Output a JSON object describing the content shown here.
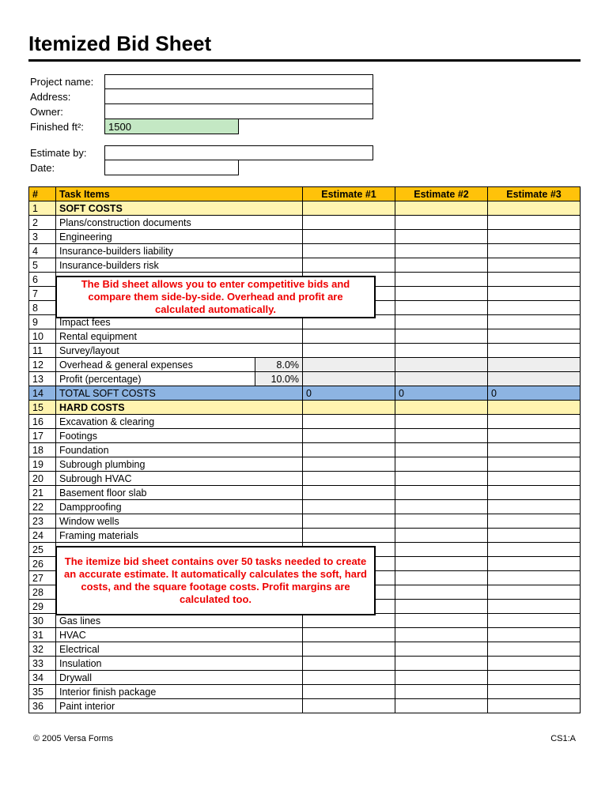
{
  "title": "Itemized Bid Sheet",
  "header": {
    "labels": {
      "project": "Project name:",
      "address": "Address:",
      "owner": "Owner:",
      "finished_ft2": "Finished ft²:",
      "estimate_by": "Estimate by:",
      "date": "Date:"
    },
    "values": {
      "project": "",
      "address": "",
      "owner": "",
      "finished_ft2": "1500",
      "estimate_by": "",
      "date": ""
    }
  },
  "columns": {
    "num": "#",
    "task": "Task Items",
    "est1": "Estimate #1",
    "est2": "Estimate #2",
    "est3": "Estimate #3"
  },
  "rows": [
    {
      "n": "1",
      "task": "SOFT COSTS",
      "class": "soft-yellow"
    },
    {
      "n": "2",
      "task": "Plans/construction documents"
    },
    {
      "n": "3",
      "task": "Engineering"
    },
    {
      "n": "4",
      "task": "Insurance-builders liability"
    },
    {
      "n": "5",
      "task": "Insurance-builders risk"
    },
    {
      "n": "6",
      "task": ""
    },
    {
      "n": "7",
      "task": ""
    },
    {
      "n": "8",
      "task": ""
    },
    {
      "n": "9",
      "task": "Impact fees"
    },
    {
      "n": "10",
      "task": "Rental equipment"
    },
    {
      "n": "11",
      "task": "Survey/layout"
    },
    {
      "n": "12",
      "task": "Overhead  & general expenses",
      "pct": "8.0%",
      "class": "gray"
    },
    {
      "n": "13",
      "task": "Profit (percentage)",
      "pct": "10.0%",
      "class": "gray"
    },
    {
      "n": "14",
      "task": "TOTAL SOFT COSTS",
      "class": "blue",
      "e1": "0",
      "e2": "0",
      "e3": "0"
    },
    {
      "n": "15",
      "task": "HARD COSTS",
      "class": "soft-yellow"
    },
    {
      "n": "16",
      "task": "Excavation & clearing"
    },
    {
      "n": "17",
      "task": "Footings"
    },
    {
      "n": "18",
      "task": "Foundation"
    },
    {
      "n": "19",
      "task": "Subrough plumbing"
    },
    {
      "n": "20",
      "task": "Subrough HVAC"
    },
    {
      "n": "21",
      "task": "Basement floor slab"
    },
    {
      "n": "22",
      "task": "Dampproofing"
    },
    {
      "n": "23",
      "task": "Window wells"
    },
    {
      "n": "24",
      "task": "Framing materials"
    },
    {
      "n": "25",
      "task": ""
    },
    {
      "n": "26",
      "task": ""
    },
    {
      "n": "27",
      "task": ""
    },
    {
      "n": "28",
      "task": ""
    },
    {
      "n": "29",
      "task": ""
    },
    {
      "n": "30",
      "task": "Gas lines"
    },
    {
      "n": "31",
      "task": "HVAC"
    },
    {
      "n": "32",
      "task": "Electrical"
    },
    {
      "n": "33",
      "task": "Insulation"
    },
    {
      "n": "34",
      "task": "Drywall"
    },
    {
      "n": "35",
      "task": "Interior finish package"
    },
    {
      "n": "36",
      "task": "Paint interior"
    }
  ],
  "notes": {
    "note1": "The Bid sheet allows you to enter competitive bids and compare them side-by-side.  Overhead and profit are calculated automatically.",
    "note2": "The itemize bid sheet contains over 50 tasks needed to create an accurate estimate.  It automatically calculates the soft, hard costs, and the square footage costs.  Profit margins are calculated too."
  },
  "footer": {
    "left": "© 2005 Versa Forms",
    "right": "CS1:A"
  }
}
